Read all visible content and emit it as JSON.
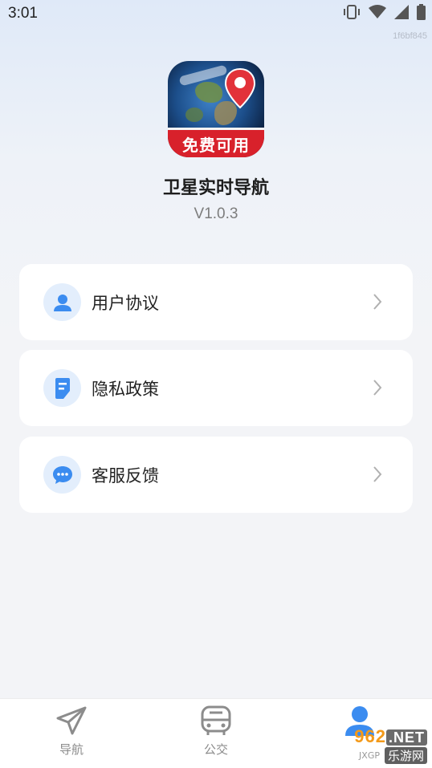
{
  "status_bar": {
    "time": "3:01",
    "icons": [
      "vibrate-icon",
      "wifi-icon",
      "signal-icon",
      "battery-icon"
    ],
    "build_id": "1f6bf845"
  },
  "header": {
    "app_icon_badge": "免费可用",
    "app_name": "卫星实时导航",
    "version": "V1.0.3"
  },
  "menu": {
    "items": [
      {
        "label": "用户协议",
        "icon": "user-icon"
      },
      {
        "label": "隐私政策",
        "icon": "document-icon"
      },
      {
        "label": "客服反馈",
        "icon": "chat-bubble-icon"
      }
    ]
  },
  "bottom_nav": {
    "items": [
      {
        "label": "导航",
        "icon": "paper-plane-icon"
      },
      {
        "label": "公交",
        "icon": "bus-icon"
      },
      {
        "label": "",
        "icon": "profile-icon",
        "active": true
      }
    ]
  },
  "watermark": {
    "brand_number": "962",
    "brand_suffix": ".NET",
    "small_text": "JXGP",
    "cn_text": "乐游网"
  },
  "colors": {
    "accent": "#3b8cf0",
    "icon_bg": "#e3eefc",
    "badge_red": "#d8212b"
  }
}
